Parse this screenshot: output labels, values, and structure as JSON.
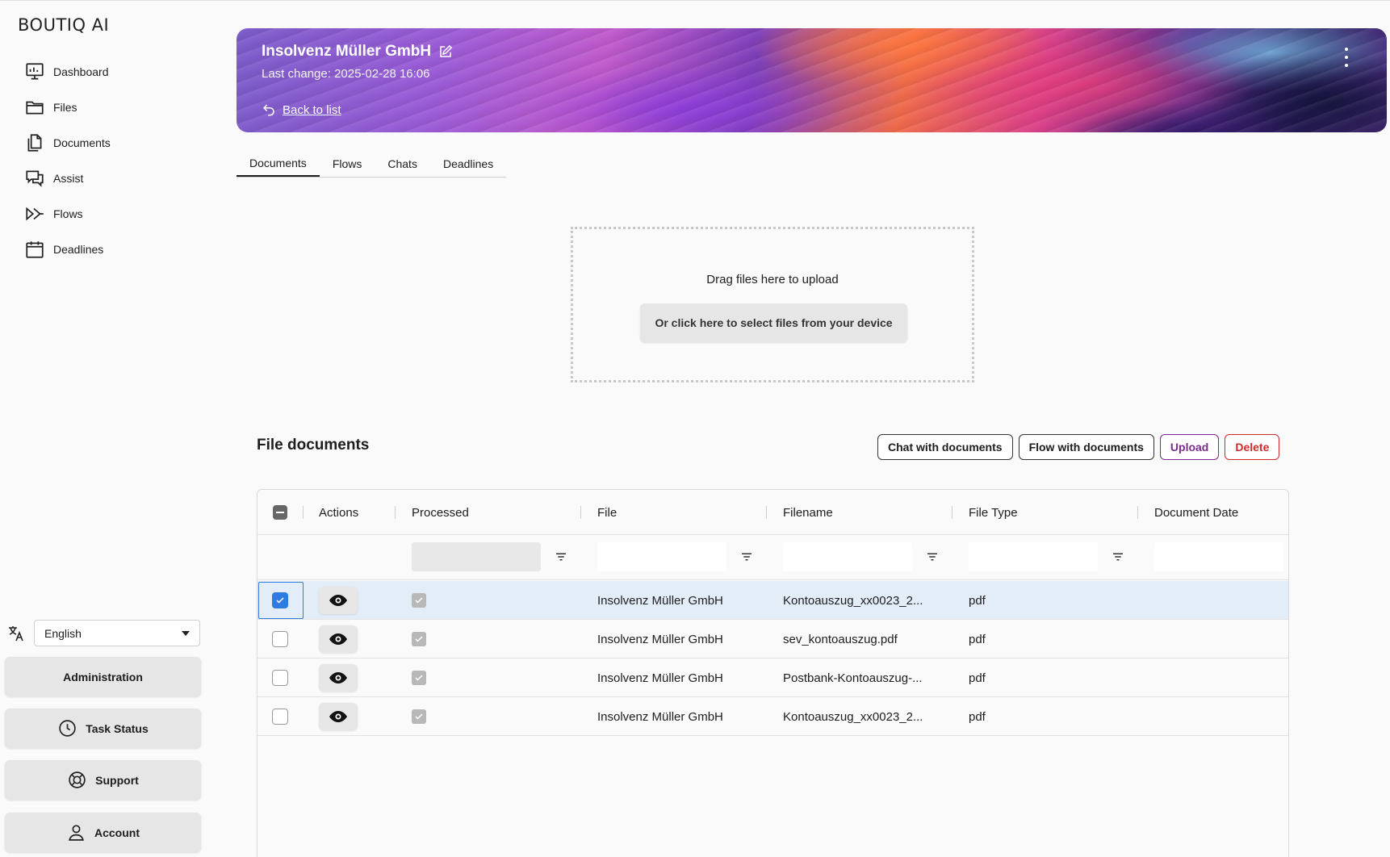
{
  "brand": {
    "logo": "BOUTIQ AI"
  },
  "sidebar": {
    "nav": [
      {
        "label": "Dashboard",
        "icon": "dashboard-icon"
      },
      {
        "label": "Files",
        "icon": "folder-icon"
      },
      {
        "label": "Documents",
        "icon": "documents-icon"
      },
      {
        "label": "Assist",
        "icon": "chat-icon"
      },
      {
        "label": "Flows",
        "icon": "flows-icon"
      },
      {
        "label": "Deadlines",
        "icon": "calendar-icon"
      }
    ],
    "language": {
      "selected": "English",
      "icon": "translate-icon"
    },
    "buttons": {
      "administration": "Administration",
      "task_status": "Task Status",
      "support": "Support",
      "account": "Account"
    }
  },
  "header": {
    "title": "Insolvenz Müller GmbH",
    "last_change": "Last change: 2025-02-28 16:06",
    "back_link": "Back to list"
  },
  "tabs": [
    {
      "label": "Documents",
      "active": true
    },
    {
      "label": "Flows",
      "active": false
    },
    {
      "label": "Chats",
      "active": false
    },
    {
      "label": "Deadlines",
      "active": false
    }
  ],
  "dropzone": {
    "text": "Drag files here to upload",
    "button": "Or click here to select files from your device"
  },
  "section": {
    "title": "File documents",
    "actions": {
      "chat": "Chat with documents",
      "flow": "Flow with documents",
      "upload": "Upload",
      "delete": "Delete"
    }
  },
  "table": {
    "columns": {
      "actions": "Actions",
      "processed": "Processed",
      "file": "File",
      "filename": "Filename",
      "filetype": "File Type",
      "document_date": "Document Date"
    },
    "rows": [
      {
        "selected": true,
        "processed": true,
        "file": "Insolvenz Müller GmbH",
        "filename": "Kontoauszug_xx0023_2...",
        "filetype": "pdf",
        "document_date": ""
      },
      {
        "selected": false,
        "processed": true,
        "file": "Insolvenz Müller GmbH",
        "filename": "sev_kontoauszug.pdf",
        "filetype": "pdf",
        "document_date": ""
      },
      {
        "selected": false,
        "processed": true,
        "file": "Insolvenz Müller GmbH",
        "filename": "Postbank-Kontoauszug-...",
        "filetype": "pdf",
        "document_date": ""
      },
      {
        "selected": false,
        "processed": true,
        "file": "Insolvenz Müller GmbH",
        "filename": "Kontoauszug_xx0023_2...",
        "filetype": "pdf",
        "document_date": ""
      }
    ]
  },
  "colors": {
    "accent": "#2f7be0",
    "upload": "#7a2a8c",
    "delete": "#d02a2a",
    "row_selected": "#e3edf8"
  }
}
